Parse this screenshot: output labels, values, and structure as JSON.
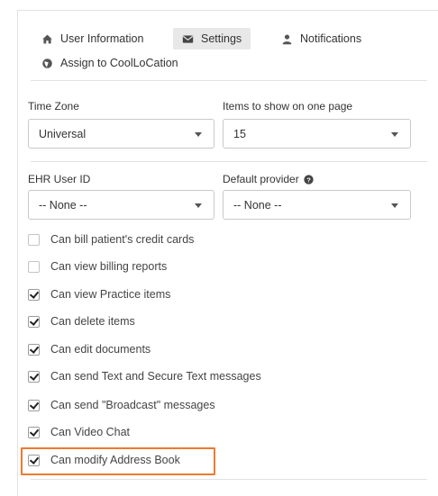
{
  "tabs": [
    {
      "label": "User Information",
      "icon": "home-icon",
      "active": false
    },
    {
      "label": "Settings",
      "icon": "envelope-icon",
      "active": true
    },
    {
      "label": "Notifications",
      "icon": "user-icon",
      "active": false
    },
    {
      "label": "Assign to CoolLoCation",
      "icon": "globe-icon",
      "active": false
    }
  ],
  "fields": {
    "time_zone": {
      "label": "Time Zone",
      "value": "Universal"
    },
    "items_per_page": {
      "label": "Items to show on one page",
      "value": "15"
    },
    "ehr_user_id": {
      "label": "EHR User ID",
      "value": "-- None --"
    },
    "default_provider": {
      "label": "Default provider",
      "value": "-- None --",
      "help_icon": "question-circle-icon"
    }
  },
  "permissions": [
    {
      "label": "Can bill patient's credit cards",
      "checked": false
    },
    {
      "label": "Can view billing reports",
      "checked": false
    },
    {
      "label": "Can view Practice items",
      "checked": true
    },
    {
      "label": "Can delete items",
      "checked": true
    },
    {
      "label": "Can edit documents",
      "checked": true
    },
    {
      "label": "Can send Text and Secure Text messages",
      "checked": true
    },
    {
      "label": "Can send \"Broadcast\" messages",
      "checked": true
    },
    {
      "label": "Can Video Chat",
      "checked": true
    },
    {
      "label": "Can modify Address Book",
      "checked": true
    }
  ],
  "colors": {
    "highlight": "#ee7a2e",
    "active_tab_bg": "#e8e8e8"
  }
}
